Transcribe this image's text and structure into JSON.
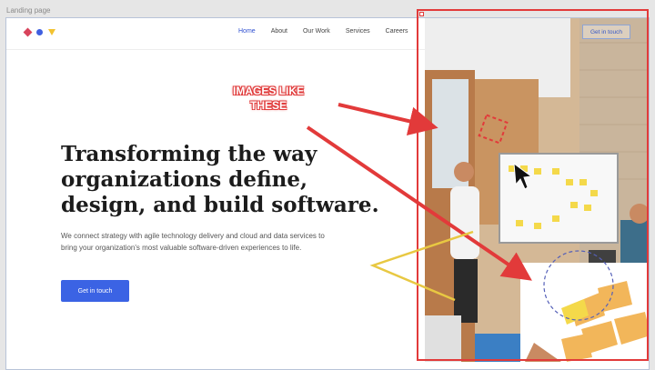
{
  "frame": {
    "label": "Landing page"
  },
  "nav": {
    "items": [
      {
        "label": "Home",
        "active": true
      },
      {
        "label": "About"
      },
      {
        "label": "Our Work"
      },
      {
        "label": "Services"
      },
      {
        "label": "Careers"
      }
    ],
    "cta_label": "Get in touch"
  },
  "hero": {
    "title_lines": [
      "Transforming the way",
      "organizations define,",
      "design, and build software."
    ],
    "subtitle_lines": [
      "We connect strategy with agile technology delivery and cloud and data services to",
      "bring your organization's most valuable software-driven experiences to life."
    ],
    "cta_label": "Get in touch"
  },
  "annotation": {
    "lines": [
      "IMAGES LIKE",
      "THESE"
    ]
  },
  "colors": {
    "accent": "#3b63e4",
    "annotation_red": "#e23a3a",
    "logo": [
      "#d8435b",
      "#3f5fe0",
      "#f2c230"
    ]
  },
  "icons": {
    "cursor": "mouse-pointer-icon",
    "logo": "brand-logo-icon"
  }
}
